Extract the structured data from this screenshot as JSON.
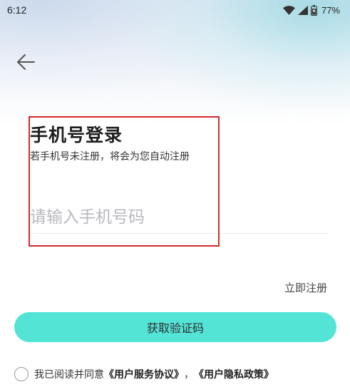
{
  "status_bar": {
    "time": "6:12",
    "battery_percent": "77%",
    "icons": [
      "wifi-icon",
      "cellular-signal-icon",
      "battery-icon"
    ]
  },
  "header": {
    "back_icon": "arrow-left-icon"
  },
  "login": {
    "title": "手机号登录",
    "subtitle": "若手机号未注册，将会为您自动注册",
    "phone_placeholder": "请输入手机号码",
    "phone_value": ""
  },
  "register_link": "立即注册",
  "get_code_button": "获取验证码",
  "agreement": {
    "checked": false,
    "prefix": "我已阅读并同意",
    "user_agreement": "《用户服务协议》",
    "separator": "，",
    "privacy_policy": "《用户隐私政策》"
  },
  "colors": {
    "accent": "#53e4d6",
    "highlight_border": "#d42a2a",
    "placeholder": "#b8b8c0"
  }
}
